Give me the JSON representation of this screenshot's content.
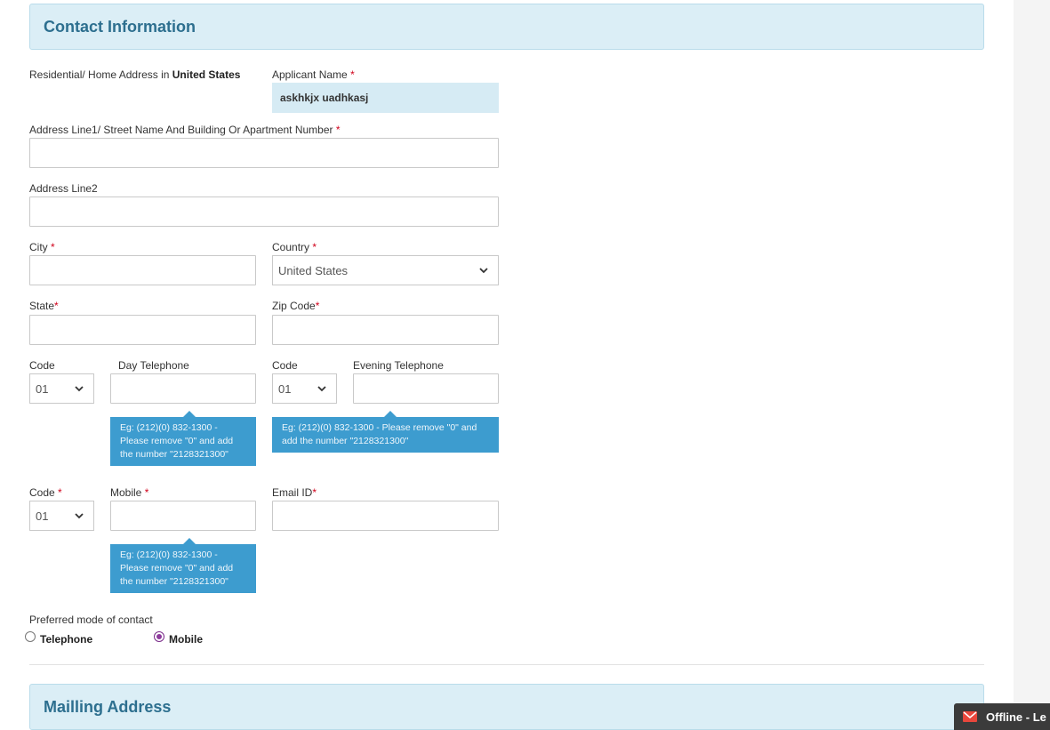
{
  "contact_section": {
    "title": "Contact Information"
  },
  "residential": {
    "prefix": "Residential/ Home Address in ",
    "country": "United States"
  },
  "applicant": {
    "label": "Applicant Name",
    "required": "*",
    "value": "askhkjx uadhkasj"
  },
  "address1": {
    "label": "Address Line1/ Street Name And Building Or Apartment Number",
    "required": "*",
    "value": ""
  },
  "address2": {
    "label": "Address Line2",
    "value": ""
  },
  "city": {
    "label": "City",
    "required": "*",
    "value": ""
  },
  "country": {
    "label": "Country",
    "required": "*",
    "selected": "United States"
  },
  "state": {
    "label": "State",
    "required": "*",
    "value": ""
  },
  "zip": {
    "label": "Zip Code",
    "required": "*",
    "value": ""
  },
  "day_phone": {
    "code_label": "Code",
    "code_selected": "01",
    "label": "Day Telephone",
    "value": "",
    "hint_lines": [
      "Eg: (212)(0) 832-1300 -",
      "Please remove \"0\" and add",
      "the number \"2128321300\""
    ]
  },
  "evening_phone": {
    "code_label": "Code",
    "code_selected": "01",
    "label": "Evening Telephone",
    "value": "",
    "hint_lines": [
      "Eg: (212)(0) 832-1300 - Please remove \"0\" and",
      "add the number \"2128321300\""
    ]
  },
  "mobile": {
    "code_label": "Code",
    "code_required": "*",
    "code_selected": "01",
    "label": "Mobile",
    "required": "*",
    "value": "",
    "hint_lines": [
      "Eg: (212)(0) 832-1300 -",
      "Please remove \"0\" and add",
      "the number \"2128321300\""
    ]
  },
  "email": {
    "label": "Email ID",
    "required": "*",
    "value": ""
  },
  "preferred": {
    "label": "Preferred mode of contact",
    "options": [
      "Telephone",
      "Mobile"
    ],
    "selected": "Mobile"
  },
  "mailing_section": {
    "title": "Mailling Address"
  },
  "chat": {
    "status": "Offline - Le",
    "icon": "mail-icon"
  },
  "colors": {
    "header_bg": "#dbeef6",
    "header_text": "#2d6f8f",
    "tip_bg": "#3d9ccf",
    "required": "#d0021b",
    "radio_checked": "#8e3a9d"
  }
}
